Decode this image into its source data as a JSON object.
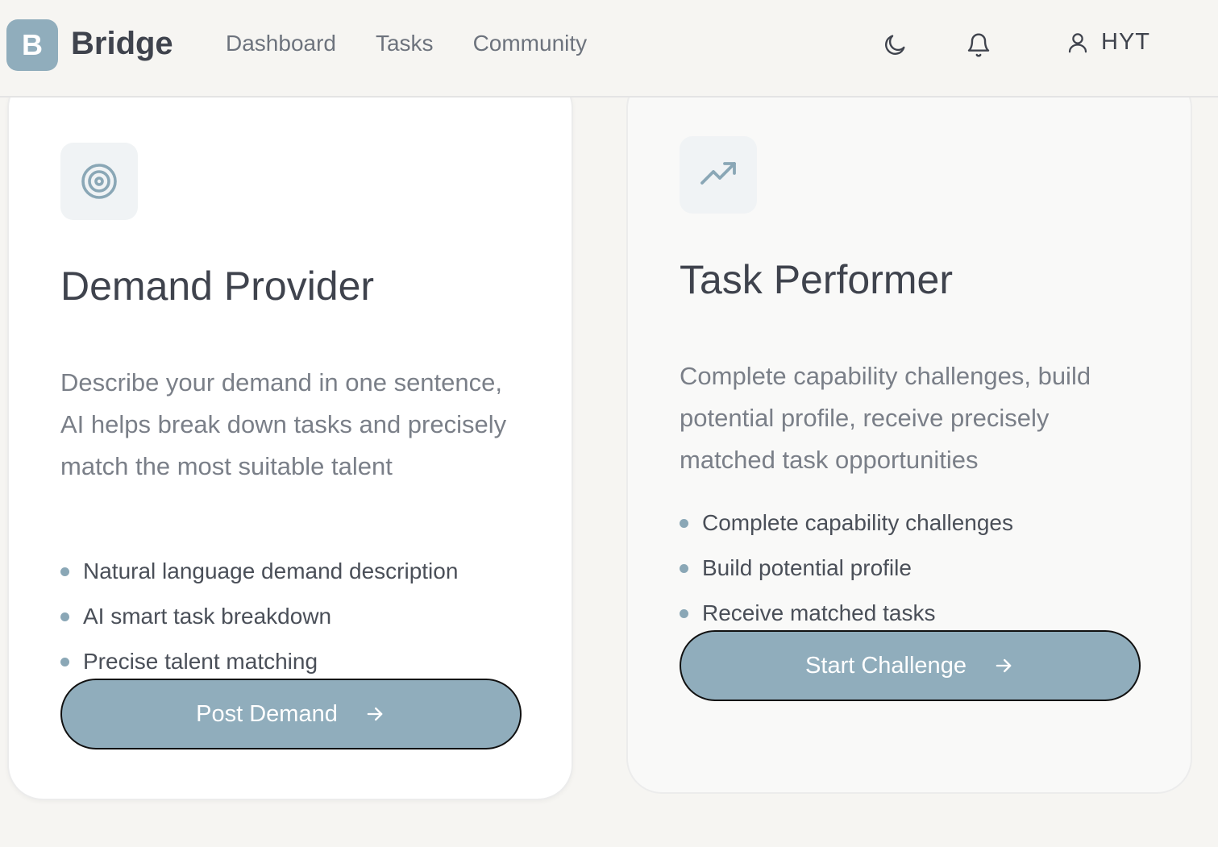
{
  "header": {
    "logo_letter": "B",
    "brand": "Bridge",
    "nav": [
      "Dashboard",
      "Tasks",
      "Community"
    ],
    "user_name": "HYT",
    "icons": [
      "moon-icon",
      "bell-icon",
      "user-icon"
    ]
  },
  "cards": {
    "demand": {
      "icon": "target-icon",
      "title": "Demand Provider",
      "description": "Describe your demand in one sentence, AI helps break down tasks and precisely match the most suitable talent",
      "features": [
        "Natural language demand description",
        "AI smart task breakdown",
        "Precise talent matching"
      ],
      "button": "Post Demand"
    },
    "performer": {
      "icon": "trending-up-icon",
      "title": "Task Performer",
      "description": "Complete capability challenges, build potential profile, receive precisely matched task opportunities",
      "features": [
        "Complete capability challenges",
        "Build potential profile",
        "Receive matched tasks"
      ],
      "button": "Start Challenge"
    }
  },
  "colors": {
    "accent": "#90adbc",
    "background": "#f6f5f2",
    "text": "#3f434d",
    "muted": "#7a7f88"
  }
}
